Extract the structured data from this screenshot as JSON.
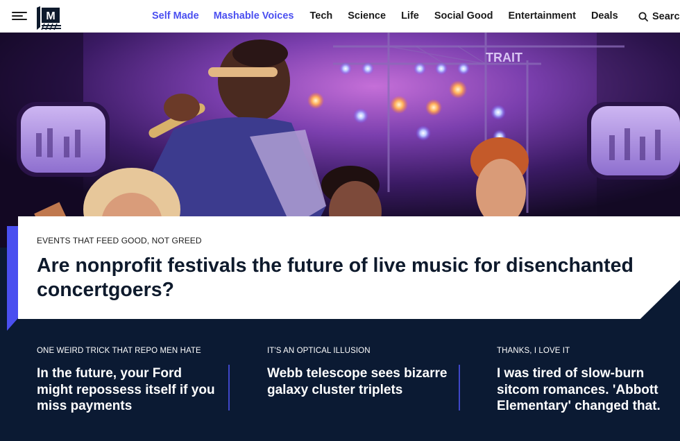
{
  "nav": {
    "menu_icon": "hamburger-menu-icon",
    "logo_text": "M",
    "links": [
      {
        "label": "Self Made",
        "accent": true
      },
      {
        "label": "Mashable Voices",
        "accent": true
      },
      {
        "label": "Tech",
        "accent": false
      },
      {
        "label": "Science",
        "accent": false
      },
      {
        "label": "Life",
        "accent": false
      },
      {
        "label": "Social Good",
        "accent": false
      },
      {
        "label": "Entertainment",
        "accent": false
      },
      {
        "label": "Deals",
        "accent": false
      }
    ],
    "search_icon": "search-icon",
    "search_label": "Search"
  },
  "hero": {
    "image_subject": "performers on a concert stage with lights, purple tint",
    "stage_sign_text": "TRAIT"
  },
  "feature": {
    "kicker": "EVENTS THAT FEED GOOD, NOT GREED",
    "title": "Are nonprofit festivals the future of live music for disenchanted concertgoers?"
  },
  "stories": [
    {
      "kicker": "ONE WEIRD TRICK THAT REPO MEN HATE",
      "title": "In the future, your Ford might repossess itself if you miss payments"
    },
    {
      "kicker": "IT'S AN OPTICAL ILLUSION",
      "title": "Webb telescope sees bizarre galaxy cluster triplets"
    },
    {
      "kicker": "THANKS, I LOVE IT",
      "title": "I was tired of slow-burn sitcom romances. 'Abbott Elementary' changed that."
    }
  ],
  "colors": {
    "accent": "#4a4ff0",
    "dark_navy": "#0b1a33",
    "white": "#ffffff"
  }
}
